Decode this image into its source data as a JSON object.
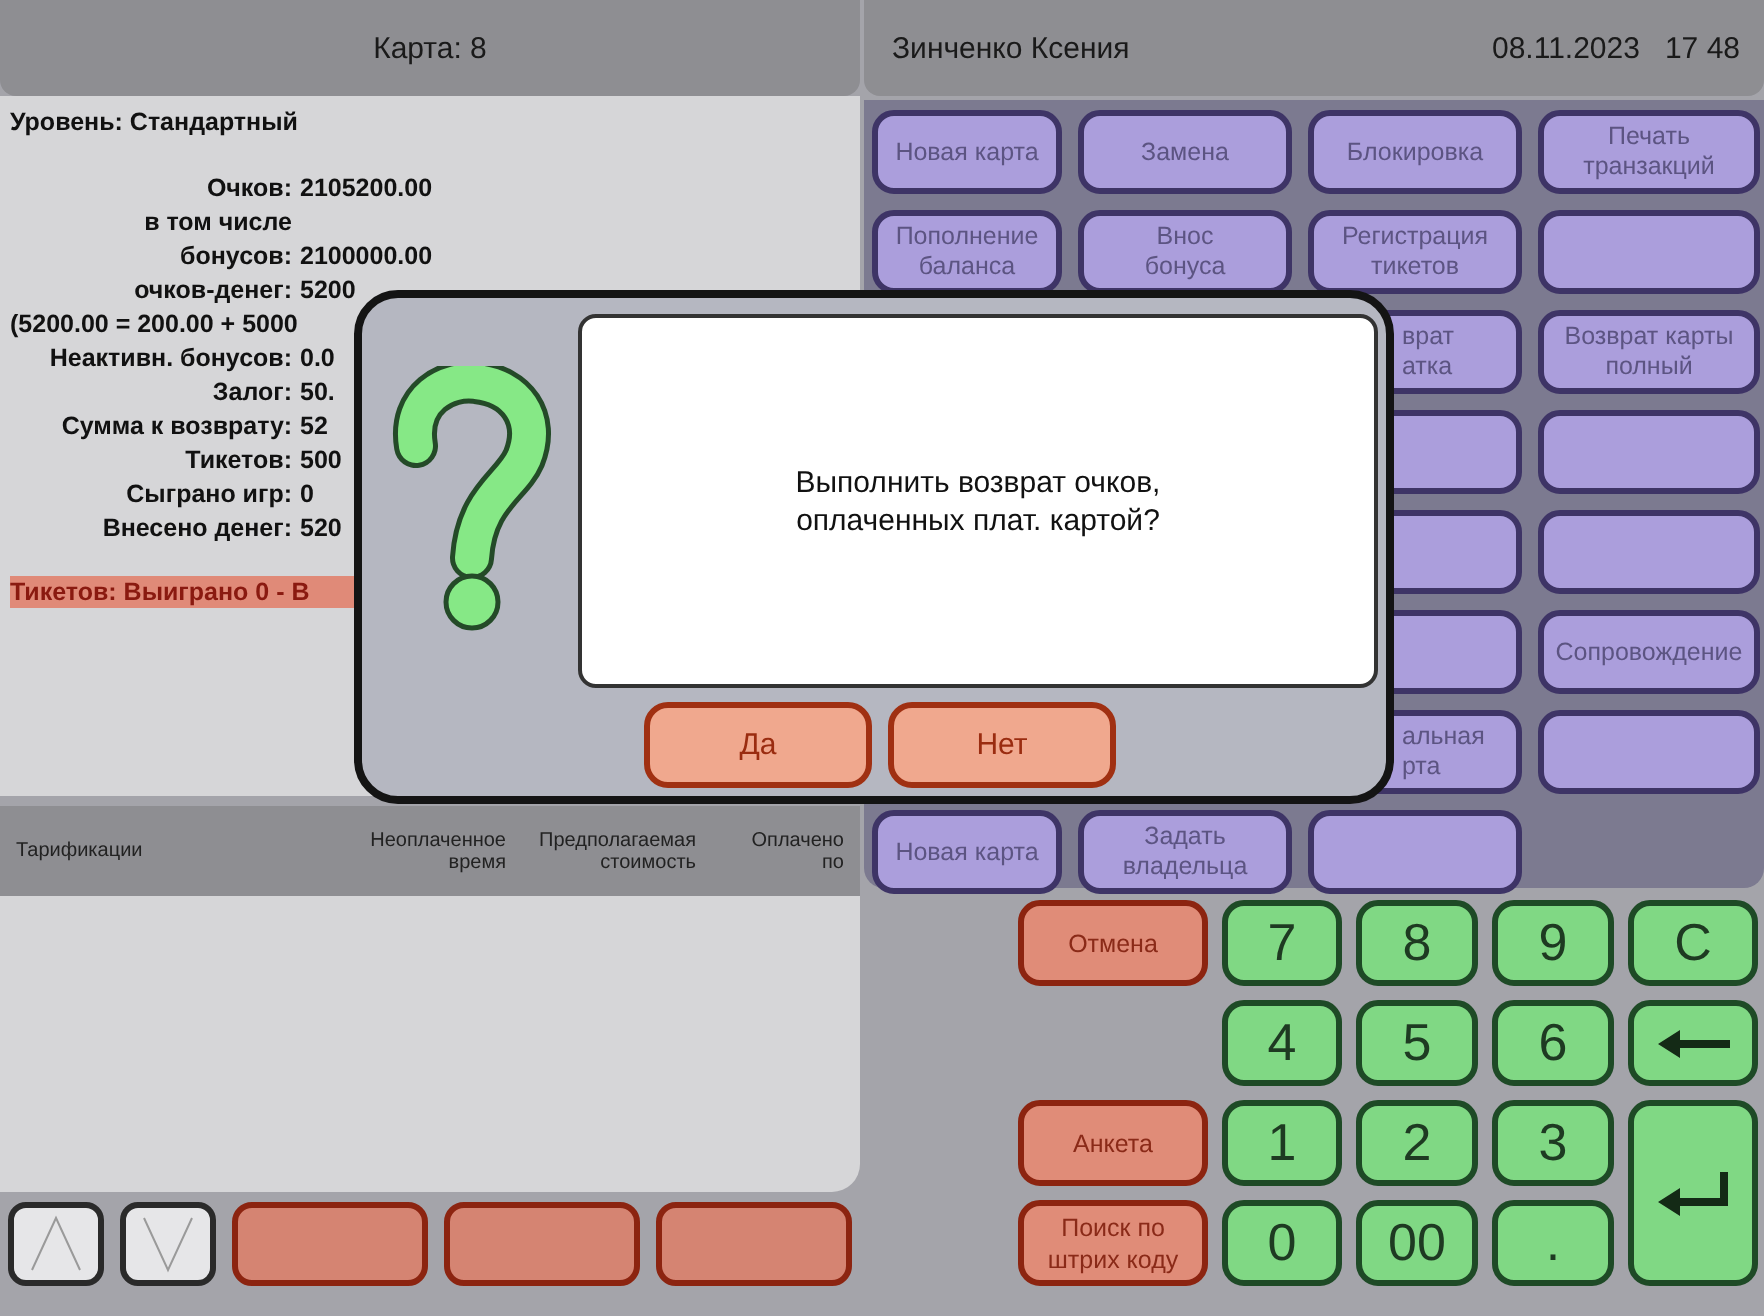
{
  "card_panel": {
    "title": "Карта: 8",
    "level": "Уровень: Стандартный",
    "rows": [
      {
        "kind": "pair",
        "label": "Очков:",
        "value": "2105200.00"
      },
      {
        "kind": "note",
        "label": "в том числе"
      },
      {
        "kind": "pair",
        "label": "бонусов:",
        "value": "2100000.00"
      },
      {
        "kind": "pair",
        "label": "очков-денег:",
        "value": "5200"
      },
      {
        "kind": "full",
        "label": "(5200.00 = 200.00 + 5000"
      },
      {
        "kind": "pair",
        "label": "Неактивн. бонусов:",
        "value": "0.0"
      },
      {
        "kind": "pair",
        "label": "Залог:",
        "value": "50."
      },
      {
        "kind": "pair",
        "label": "Сумма к возврату:",
        "value": "52"
      },
      {
        "kind": "pair",
        "label": "Тикетов:",
        "value": "500"
      },
      {
        "kind": "pair",
        "label": "Сыграно игр:",
        "value": "0"
      },
      {
        "kind": "pair",
        "label": "Внесено денег:",
        "value": "520"
      }
    ],
    "tickets_line": "Тикетов: Выиграно 0 - В"
  },
  "tariff_table": {
    "columns": [
      "Тарификации",
      "Неоплаченное время",
      "Предполагаемая стоимость",
      "Оплачено по"
    ]
  },
  "header": {
    "operator": "Зинченко Ксения",
    "date": "08.11.2023",
    "time": "17 48"
  },
  "actions": [
    {
      "kind": "label",
      "label": "Новая карта"
    },
    {
      "kind": "label",
      "label": "Замена"
    },
    {
      "kind": "label",
      "label": "Блокировка"
    },
    {
      "kind": "label",
      "label": "Печать\nтранзакций"
    },
    {
      "kind": "label",
      "label": "Пополнение\nбаланса"
    },
    {
      "kind": "label",
      "label": "Внос\nбонуса"
    },
    {
      "kind": "label",
      "label": "Регистрация\nтикетов"
    },
    {
      "kind": "blank"
    },
    {
      "kind": "none"
    },
    {
      "kind": "none"
    },
    {
      "kind": "partial",
      "label": "врат\nатка"
    },
    {
      "kind": "label",
      "label": "Возврат карты\nполный"
    },
    {
      "kind": "none"
    },
    {
      "kind": "none"
    },
    {
      "kind": "blank"
    },
    {
      "kind": "blank"
    },
    {
      "kind": "none"
    },
    {
      "kind": "none"
    },
    {
      "kind": "blank"
    },
    {
      "kind": "blank"
    },
    {
      "kind": "none"
    },
    {
      "kind": "none"
    },
    {
      "kind": "blank"
    },
    {
      "kind": "label",
      "label": "Сопровождение"
    },
    {
      "kind": "none"
    },
    {
      "kind": "none"
    },
    {
      "kind": "partial",
      "label": "альная\nрта"
    },
    {
      "kind": "blank"
    },
    {
      "kind": "label",
      "label": "Новая карта"
    },
    {
      "kind": "label",
      "label": "Задать\nвладельца"
    },
    {
      "kind": "blank"
    },
    {
      "kind": "none"
    }
  ],
  "side_buttons": [
    {
      "kind": "label",
      "label": "Отмена"
    },
    {
      "kind": "none"
    },
    {
      "kind": "label",
      "label": "Анкета"
    },
    {
      "kind": "label",
      "label": "Поиск по\nштрих коду"
    }
  ],
  "keypad": [
    {
      "kind": "key",
      "label": "7"
    },
    {
      "kind": "key",
      "label": "8"
    },
    {
      "kind": "key",
      "label": "9"
    },
    {
      "kind": "key",
      "label": "C"
    },
    {
      "kind": "key",
      "label": "4"
    },
    {
      "kind": "key",
      "label": "5"
    },
    {
      "kind": "key",
      "label": "6"
    },
    {
      "kind": "backspace"
    },
    {
      "kind": "key",
      "label": "1"
    },
    {
      "kind": "key",
      "label": "2"
    },
    {
      "kind": "key",
      "label": "3"
    },
    {
      "kind": "enter"
    },
    {
      "kind": "key",
      "label": "0"
    },
    {
      "kind": "key",
      "label": "00"
    },
    {
      "kind": "key",
      "label": "."
    }
  ],
  "dialog": {
    "message": "Выполнить возврат очков,\nоплаченных плат. картой?",
    "buttons": [
      "Да",
      "Нет"
    ]
  }
}
